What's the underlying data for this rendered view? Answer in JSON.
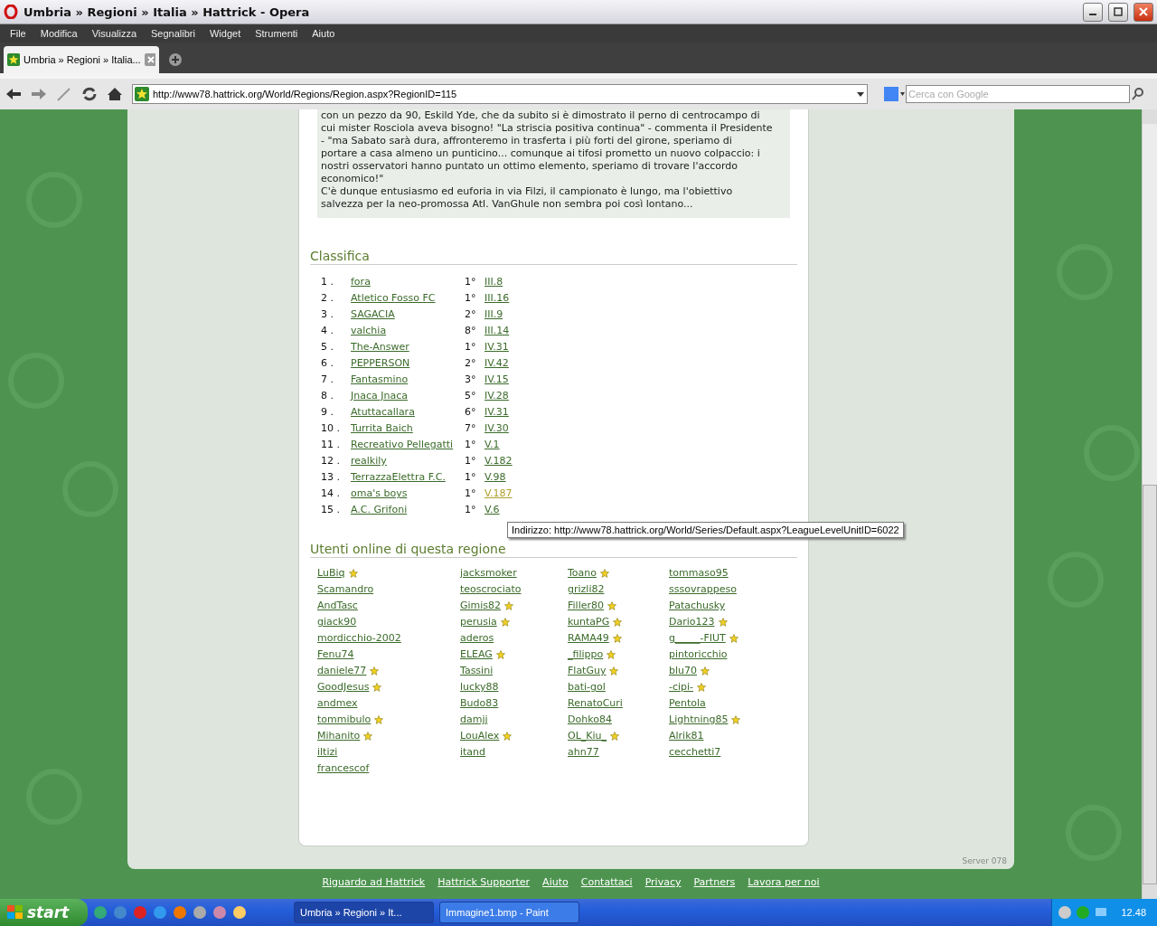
{
  "window": {
    "title": "Umbria » Regioni » Italia » Hattrick - Opera"
  },
  "menu": [
    "File",
    "Modifica",
    "Visualizza",
    "Segnalibri",
    "Widget",
    "Strumenti",
    "Aiuto"
  ],
  "tabs": [
    {
      "label": "Umbria » Regioni » Italia...",
      "selected": true
    }
  ],
  "address": {
    "value": "http://www78.hattrick.org/World/Regions/Region.aspx?RegionID=115"
  },
  "search": {
    "placeholder": "Cerca con Google"
  },
  "article": {
    "lines": [
      "con un pezzo da 90, Eskild Yde, che da subito si è dimostrato il perno di centrocampo di",
      "cui mister Rosciola aveva bisogno! \"La striscia positiva continua\" - commenta il Presidente",
      "- \"ma Sabato sarà dura, affronteremo in trasferta i più forti del girone, speriamo di",
      "portare a casa almeno un punticino... comunque ai tifosi prometto un nuovo colpaccio: i",
      "nostri osservatori hanno puntato un ottimo elemento, speriamo di trovare l'accordo",
      "economico!\"",
      "C'è dunque entusiasmo ed euforia in via Filzi, il campionato è lungo, ma l'obiettivo",
      "salvezza per la neo-promossa Atl. VanGhule non sembra poi così lontano..."
    ]
  },
  "standings": {
    "title": "Classifica",
    "rows": [
      {
        "rank": "1 .",
        "team": "fora",
        "place": "1°",
        "series": "III.8",
        "hovered": false
      },
      {
        "rank": "2 .",
        "team": "Atletico Fosso FC",
        "place": "1°",
        "series": "III.16",
        "hovered": false
      },
      {
        "rank": "3 .",
        "team": "SAGACIA",
        "place": "2°",
        "series": "III.9",
        "hovered": false
      },
      {
        "rank": "4 .",
        "team": "valchia",
        "place": "8°",
        "series": "III.14",
        "hovered": false
      },
      {
        "rank": "5 .",
        "team": "The-Answer",
        "place": "1°",
        "series": "IV.31",
        "hovered": false
      },
      {
        "rank": "6 .",
        "team": "PEPPERSON",
        "place": "2°",
        "series": "IV.42",
        "hovered": false
      },
      {
        "rank": "7 .",
        "team": "Fantasmino",
        "place": "3°",
        "series": "IV.15",
        "hovered": false
      },
      {
        "rank": "8 .",
        "team": "Jnaca Jnaca",
        "place": "5°",
        "series": "IV.28",
        "hovered": false
      },
      {
        "rank": "9 .",
        "team": "Atuttacallara",
        "place": "6°",
        "series": "IV.31",
        "hovered": false
      },
      {
        "rank": "10 .",
        "team": "Turrita Baich",
        "place": "7°",
        "series": "IV.30",
        "hovered": false
      },
      {
        "rank": "11 .",
        "team": "Recreativo Pellegatti",
        "place": "1°",
        "series": "V.1",
        "hovered": false
      },
      {
        "rank": "12 .",
        "team": "realkily",
        "place": "1°",
        "series": "V.182",
        "hovered": false
      },
      {
        "rank": "13 .",
        "team": "TerrazzaElettra F.C.",
        "place": "1°",
        "series": "V.98",
        "hovered": false
      },
      {
        "rank": "14 .",
        "team": "oma's boys",
        "place": "1°",
        "series": "V.187",
        "hovered": true
      },
      {
        "rank": "15 .",
        "team": "A.C. Grifoni",
        "place": "1°",
        "series": "V.6",
        "hovered": false
      }
    ]
  },
  "tooltip": "Indirizzo: http://www78.hattrick.org/World/Series/Default.aspx?LeagueLevelUnitID=6022",
  "online": {
    "title": "Utenti online di questa regione",
    "columns": [
      [
        {
          "name": "LuBiq",
          "supporter": true
        },
        {
          "name": "Scamandro",
          "supporter": false
        },
        {
          "name": "AndTasc",
          "supporter": false
        },
        {
          "name": "giack90",
          "supporter": false
        },
        {
          "name": "mordicchio-2002",
          "supporter": false
        },
        {
          "name": "Fenu74",
          "supporter": false
        },
        {
          "name": "daniele77",
          "supporter": true
        },
        {
          "name": "GoodJesus",
          "supporter": true
        },
        {
          "name": "andmex",
          "supporter": false
        },
        {
          "name": "tommibulo",
          "supporter": true
        },
        {
          "name": "Mihanito",
          "supporter": true
        },
        {
          "name": "iltizi",
          "supporter": false
        },
        {
          "name": "francescof",
          "supporter": false
        }
      ],
      [
        {
          "name": "jacksmoker",
          "supporter": false
        },
        {
          "name": "teoscrociato",
          "supporter": false
        },
        {
          "name": "Gimis82",
          "supporter": true
        },
        {
          "name": "perusia",
          "supporter": true
        },
        {
          "name": "aderos",
          "supporter": false
        },
        {
          "name": "ELEAG",
          "supporter": true
        },
        {
          "name": "Tassini",
          "supporter": false
        },
        {
          "name": "lucky88",
          "supporter": false
        },
        {
          "name": "Budo83",
          "supporter": false
        },
        {
          "name": "damjj",
          "supporter": false
        },
        {
          "name": "LouAlex",
          "supporter": true
        },
        {
          "name": "itand",
          "supporter": false
        }
      ],
      [
        {
          "name": "Toano",
          "supporter": true
        },
        {
          "name": "grizli82",
          "supporter": false
        },
        {
          "name": "Filler80",
          "supporter": true
        },
        {
          "name": "kuntaPG",
          "supporter": true
        },
        {
          "name": "RAMA49",
          "supporter": true
        },
        {
          "name": "_filippo",
          "supporter": true
        },
        {
          "name": "FlatGuy",
          "supporter": true
        },
        {
          "name": "bati-gol",
          "supporter": false
        },
        {
          "name": "RenatoCuri",
          "supporter": false
        },
        {
          "name": "Dohko84",
          "supporter": false
        },
        {
          "name": "OL_Kiu_",
          "supporter": true
        },
        {
          "name": "ahn77",
          "supporter": false
        }
      ],
      [
        {
          "name": "tommaso95",
          "supporter": false
        },
        {
          "name": "sssovrappeso",
          "supporter": false
        },
        {
          "name": "Patachusky",
          "supporter": false
        },
        {
          "name": "Dario123",
          "supporter": true
        },
        {
          "name": "g_____-FIUT",
          "supporter": true
        },
        {
          "name": "pintoricchio",
          "supporter": false
        },
        {
          "name": "blu70",
          "supporter": true
        },
        {
          "name": "-cipi-",
          "supporter": true
        },
        {
          "name": "Pentola",
          "supporter": false
        },
        {
          "name": "Lightning85",
          "supporter": true
        },
        {
          "name": "Alrik81",
          "supporter": false
        },
        {
          "name": "cecchetti7",
          "supporter": false
        }
      ]
    ]
  },
  "server": "Server 078",
  "footer": [
    "Riguardo ad Hattrick",
    "Hattrick Supporter",
    "Aiuto",
    "Contattaci",
    "Privacy",
    "Partners",
    "Lavora per noi"
  ],
  "taskbar": {
    "start": "start",
    "tasks": [
      {
        "label": "Umbria » Regioni » It...",
        "selected": true
      },
      {
        "label": "Immagine1.bmp - Paint",
        "selected": false
      }
    ],
    "clock": "12.48"
  }
}
